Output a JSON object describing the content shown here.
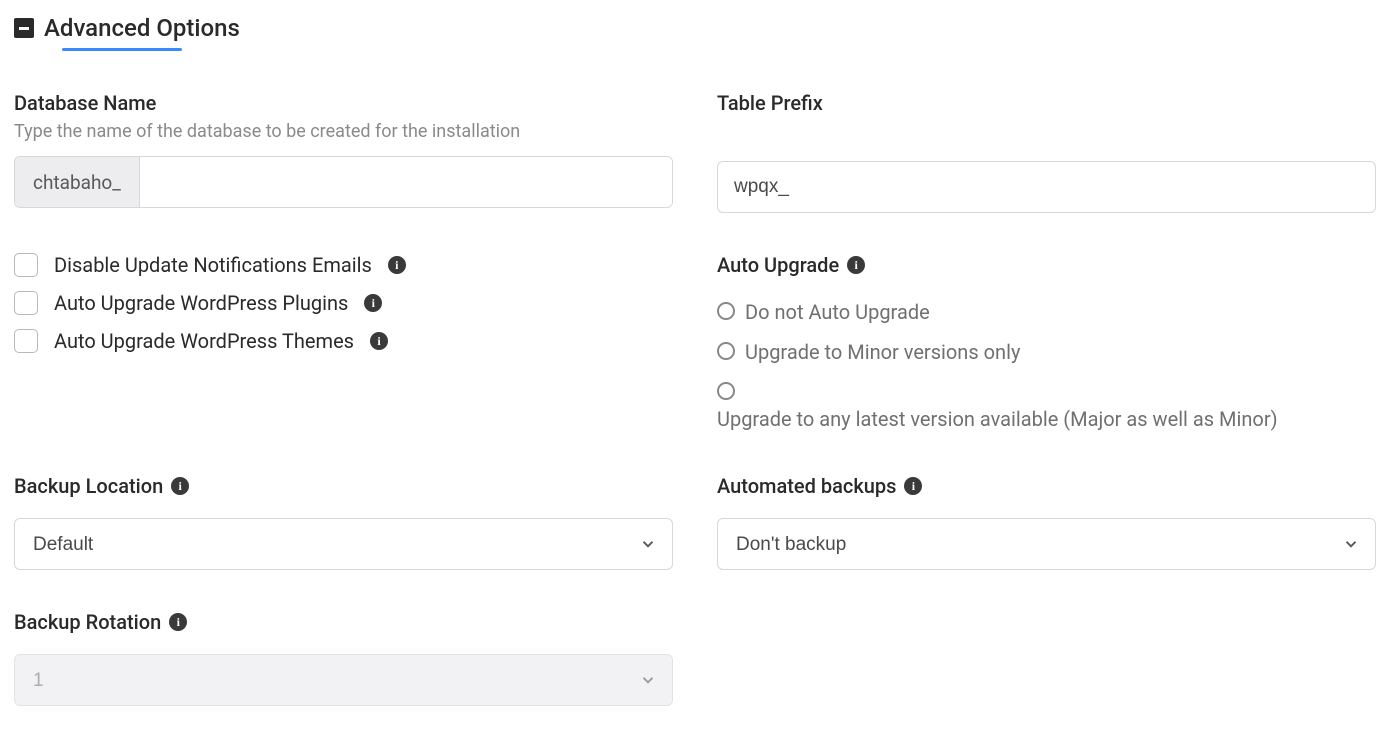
{
  "section": {
    "title": "Advanced Options"
  },
  "databaseName": {
    "label": "Database Name",
    "hint": "Type the name of the database to be created for the installation",
    "prefix": "chtabaho_",
    "value": ""
  },
  "tablePrefix": {
    "label": "Table Prefix",
    "value": "wpqx_"
  },
  "checkboxes": {
    "disableUpdateEmails": "Disable Update Notifications Emails",
    "autoUpgradePlugins": "Auto Upgrade WordPress Plugins",
    "autoUpgradeThemes": "Auto Upgrade WordPress Themes"
  },
  "autoUpgrade": {
    "label": "Auto Upgrade",
    "options": {
      "none": "Do not Auto Upgrade",
      "minor": "Upgrade to Minor versions only",
      "major": "Upgrade to any latest version available (Major as well as Minor)"
    }
  },
  "backupLocation": {
    "label": "Backup Location",
    "selected": "Default"
  },
  "automatedBackups": {
    "label": "Automated backups",
    "selected": "Don't backup"
  },
  "backupRotation": {
    "label": "Backup Rotation",
    "selected": "1"
  }
}
